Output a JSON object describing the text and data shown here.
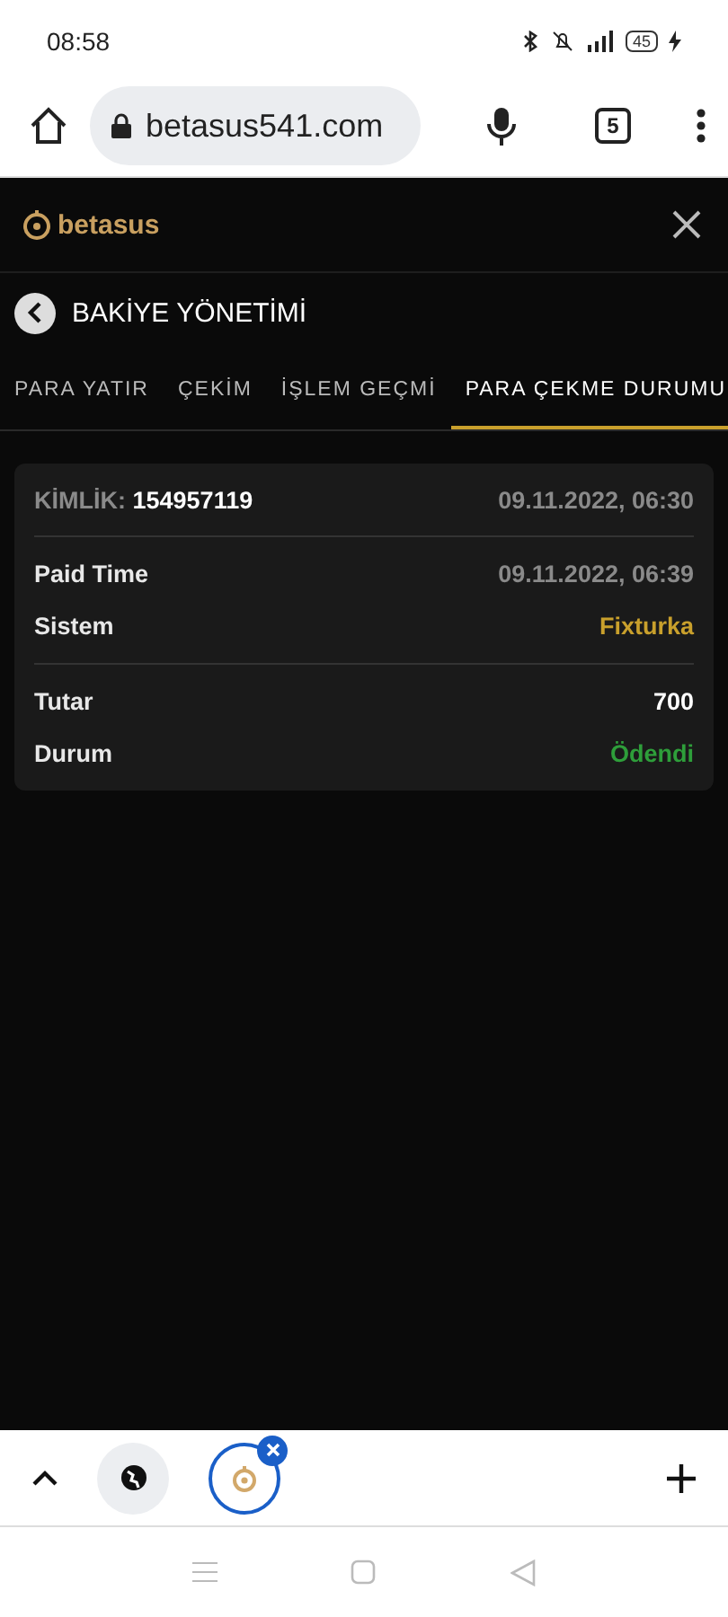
{
  "status_bar": {
    "time": "08:58",
    "battery": "45"
  },
  "browser": {
    "url": "betasus541.com",
    "tab_count": "5"
  },
  "site": {
    "logo": "betasus"
  },
  "page": {
    "title": "BAKİYE YÖNETİMİ"
  },
  "tabs": [
    {
      "label": "PARA YATIR",
      "selected": false
    },
    {
      "label": "ÇEKİM",
      "selected": false
    },
    {
      "label": "İŞLEM GEÇMİ",
      "selected": false
    },
    {
      "label": "PARA ÇEKME DURUMU",
      "selected": true
    }
  ],
  "record": {
    "id_label": "KİMLİK:",
    "id": "154957119",
    "created": "09.11.2022, 06:30",
    "groups": [
      [
        {
          "label": "Paid Time",
          "value": "09.11.2022, 06:39",
          "color": "#8a8a8a"
        },
        {
          "label": "Sistem",
          "value": "Fixturka",
          "color": "#c9a02c"
        }
      ],
      [
        {
          "label": "Tutar",
          "value": "700",
          "color": "#ffffff"
        },
        {
          "label": "Durum",
          "value": "Ödendi",
          "color": "#2e9e3a"
        }
      ]
    ]
  }
}
